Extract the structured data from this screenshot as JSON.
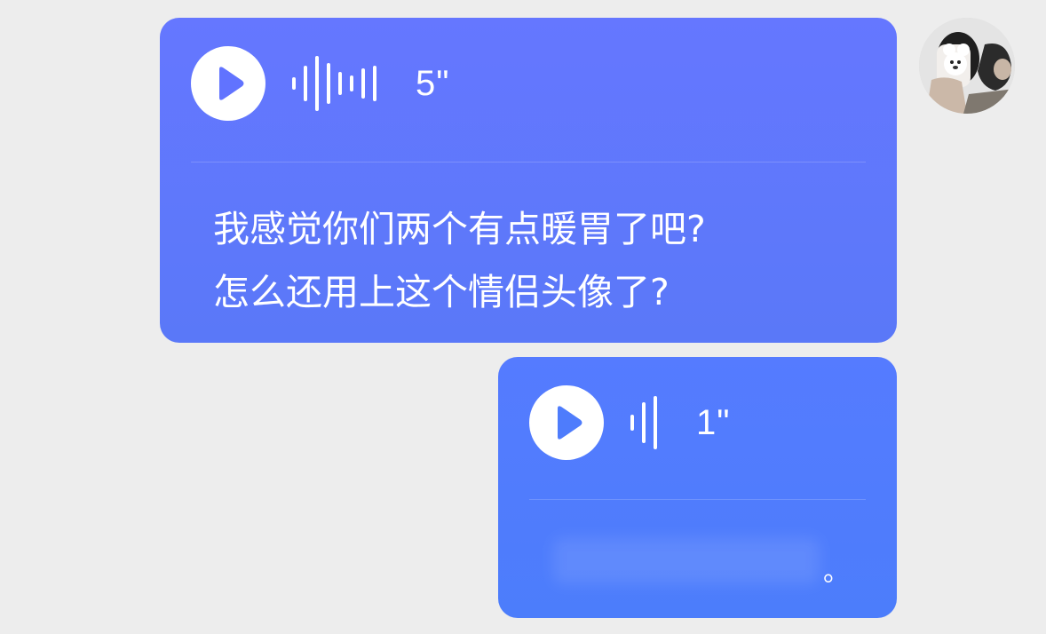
{
  "messages": [
    {
      "duration": "5\"",
      "transcript": "我感觉你们两个有点暖胃了吧?\n怎么还用上这个情侣头像了?",
      "waveform_heights": [
        14,
        40,
        62,
        46,
        26,
        18,
        34,
        40
      ]
    },
    {
      "duration": "1\"",
      "transcript_end": "。",
      "waveform_heights": [
        18,
        46,
        60
      ]
    }
  ],
  "icons": {
    "play": "play-icon"
  },
  "colors": {
    "background": "#EDEDED",
    "bubble1": "#6177FF",
    "bubble2": "#507CFC",
    "text": "#FFFFFF"
  }
}
